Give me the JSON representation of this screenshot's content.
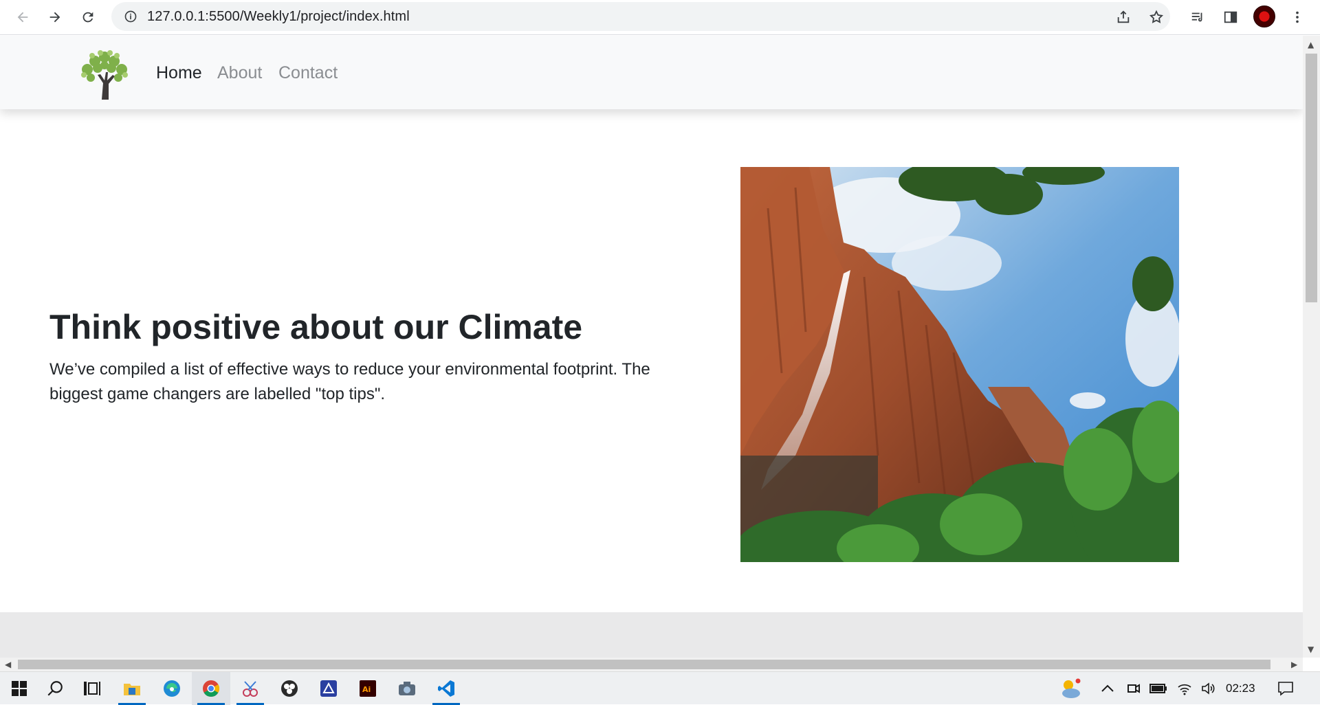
{
  "browser": {
    "url": "127.0.0.1:5500/Weekly1/project/index.html",
    "icons": [
      "back-arrow-icon",
      "forward-arrow-icon",
      "reload-icon",
      "info-icon",
      "share-icon",
      "star-icon",
      "reading-list-icon",
      "side-panel-icon",
      "profile-avatar",
      "kebab-menu-icon"
    ]
  },
  "site": {
    "nav": {
      "home": "Home",
      "about": "About",
      "contact": "Contact"
    },
    "hero": {
      "title": "Think positive about our Climate",
      "text": "We’ve compiled a list of effective ways to reduce your environmental footprint. The biggest game changers are labelled \"top tips\"."
    },
    "colors": {
      "nav_bg": "#f8f9fa",
      "text": "#212529",
      "muted_link": "#8a8d91",
      "band": "#e9e9ea"
    }
  },
  "taskbar": {
    "apps": [
      "windows-start-icon",
      "search-icon",
      "task-view-icon",
      "file-explorer-icon",
      "edge-icon",
      "chrome-icon",
      "snipping-tool-icon",
      "obs-icon",
      "azure-data-studio-icon",
      "illustrator-icon",
      "camera-icon",
      "vscode-icon"
    ],
    "tray": [
      "weather-icon",
      "chevron-up-icon",
      "meet-now-icon",
      "battery-icon",
      "wifi-icon",
      "volume-icon",
      "notification-icon"
    ],
    "time": "02:23"
  }
}
